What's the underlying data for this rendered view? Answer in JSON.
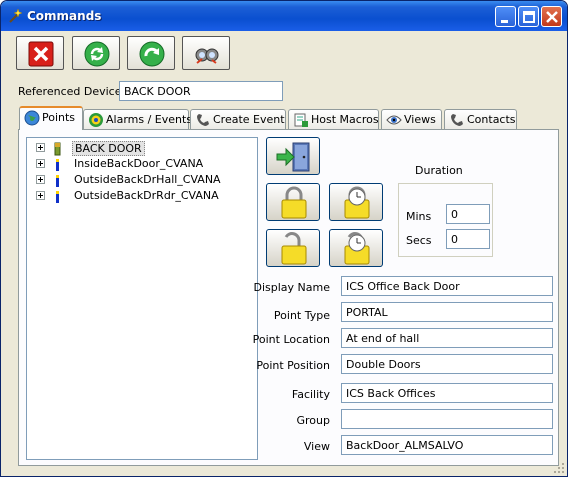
{
  "window": {
    "title": "Commands"
  },
  "title_controls": [
    "minimize-icon",
    "maximize-icon",
    "close-icon"
  ],
  "toolbar": [
    "cancel-x-icon",
    "refresh-icon",
    "apply-arrow-icon",
    "binoculars-icon"
  ],
  "referenced_device": {
    "label": "Referenced Device",
    "value": "BACK DOOR"
  },
  "tabs": [
    {
      "label": "Points",
      "icon": "globe-icon",
      "active": true
    },
    {
      "label": "Alarms / Events",
      "icon": "target-icon"
    },
    {
      "label": "Create Event",
      "icon": "phone-icon"
    },
    {
      "label": "Host Macros",
      "icon": "macro-icon"
    },
    {
      "label": "Views",
      "icon": "eye-icon"
    },
    {
      "label": "Contacts",
      "icon": "phone-icon"
    }
  ],
  "tree": [
    {
      "label": "BACK DOOR",
      "icon": "door-icon",
      "selected": true
    },
    {
      "label": "InsideBackDoor_CVANA",
      "icon": "reader-icon"
    },
    {
      "label": "OutsideBackDrHall_CVANA",
      "icon": "reader-icon"
    },
    {
      "label": "OutsideBackDrRdr_CVANA",
      "icon": "reader-icon"
    }
  ],
  "actions": [
    "door-exit-icon",
    "lock-icon",
    "timed-lock-icon",
    "unlock-icon",
    "timed-unlock-icon"
  ],
  "duration": {
    "title": "Duration",
    "mins_label": "Mins",
    "mins_value": "0",
    "secs_label": "Secs",
    "secs_value": "0"
  },
  "details": {
    "display_name": {
      "label": "Display Name",
      "value": "ICS Office Back Door"
    },
    "point_type": {
      "label": "Point Type",
      "value": "PORTAL"
    },
    "point_location": {
      "label": "Point Location",
      "value": "At end of hall"
    },
    "point_position": {
      "label": "Point Position",
      "value": "Double Doors"
    },
    "facility": {
      "label": "Facility",
      "value": "ICS Back Offices"
    },
    "group": {
      "label": "Group",
      "value": ""
    },
    "view": {
      "label": "View",
      "value": "BackDoor_ALMSALVO"
    }
  }
}
